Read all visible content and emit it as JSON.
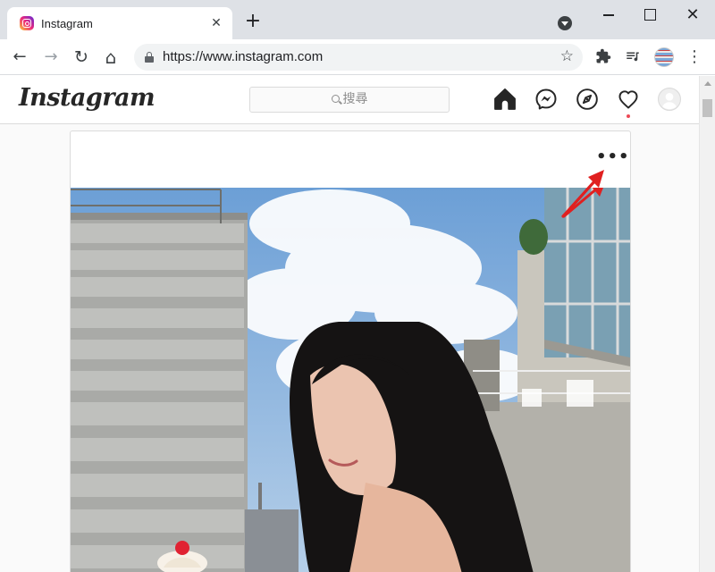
{
  "browser": {
    "tab": {
      "title": "Instagram",
      "close_glyph": "✕"
    },
    "new_tab_glyph": "+",
    "window": {
      "close_glyph": "✕"
    },
    "toolbar": {
      "back_glyph": "←",
      "forward_glyph": "→",
      "reload_glyph": "↻",
      "home_glyph": "⌂",
      "url": "https://www.instagram.com",
      "star_glyph": "☆",
      "menu_glyph": "⋮"
    }
  },
  "instagram": {
    "logo_text": "Instagram",
    "search": {
      "placeholder": "搜尋"
    },
    "nav_icons": [
      "home-icon",
      "messenger-icon",
      "explore-icon",
      "activity-heart-icon",
      "profile-avatar-icon"
    ],
    "notification_dot_color": "#ed4956",
    "post": {
      "more_options_glyph": "•••",
      "annotation_arrow_color": "#e02020"
    }
  }
}
